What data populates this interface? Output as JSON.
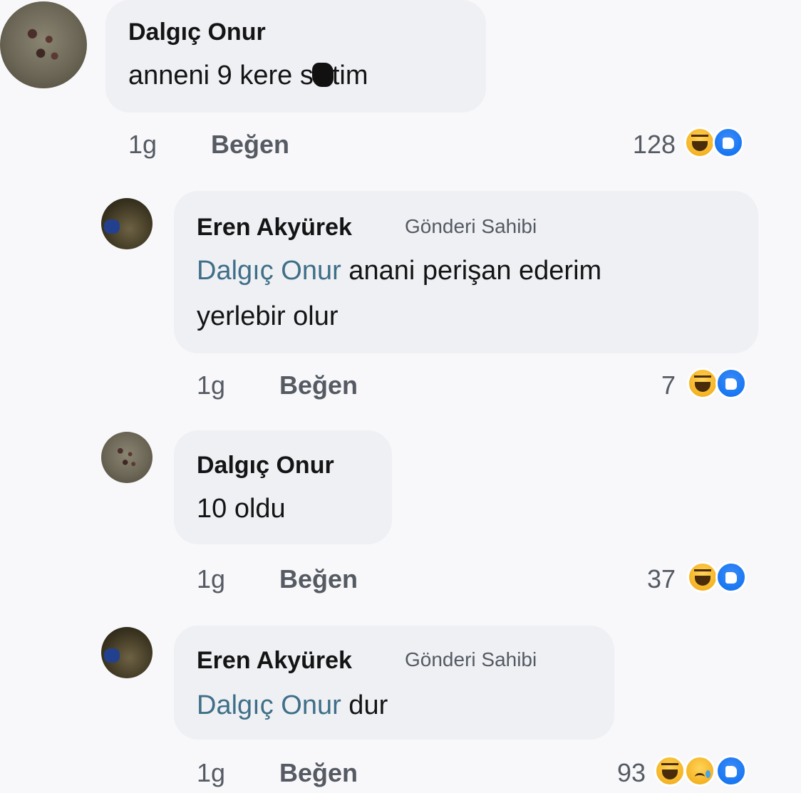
{
  "comments": [
    {
      "author": "Dalgıç Onur",
      "badge": "",
      "mention": "",
      "text_before": "anneni 9 kere s",
      "text_after": "tim",
      "censored": true,
      "text_line2": "",
      "time": "1g",
      "like_label": "Beğen",
      "reaction_count": "128",
      "reactions": [
        "haha-icon",
        "like-icon"
      ]
    },
    {
      "author": "Eren Akyürek",
      "badge": "Gönderi Sahibi",
      "mention": "Dalgıç Onur",
      "text_before": " anani perişan ederim",
      "text_line2": "yerlebir olur",
      "time": "1g",
      "like_label": "Beğen",
      "reaction_count": "7",
      "reactions": [
        "haha-icon",
        "like-icon"
      ]
    },
    {
      "author": "Dalgıç Onur",
      "badge": "",
      "mention": "",
      "text_before": "10 oldu",
      "text_line2": "",
      "time": "1g",
      "like_label": "Beğen",
      "reaction_count": "37",
      "reactions": [
        "haha-icon",
        "like-icon"
      ]
    },
    {
      "author": "Eren Akyürek",
      "badge": "Gönderi Sahibi",
      "mention": "Dalgıç Onur",
      "text_before": " dur",
      "text_line2": "",
      "time": "1g",
      "like_label": "Beğen",
      "reaction_count": "93",
      "reactions": [
        "haha-icon",
        "sad-icon",
        "like-icon"
      ]
    }
  ],
  "colors": {
    "background": "#f8f8fa",
    "bubble": "#eef0f4",
    "mention": "#3f6f88",
    "like_blue": "#1877f2",
    "haha_yellow": "#f5b323"
  }
}
